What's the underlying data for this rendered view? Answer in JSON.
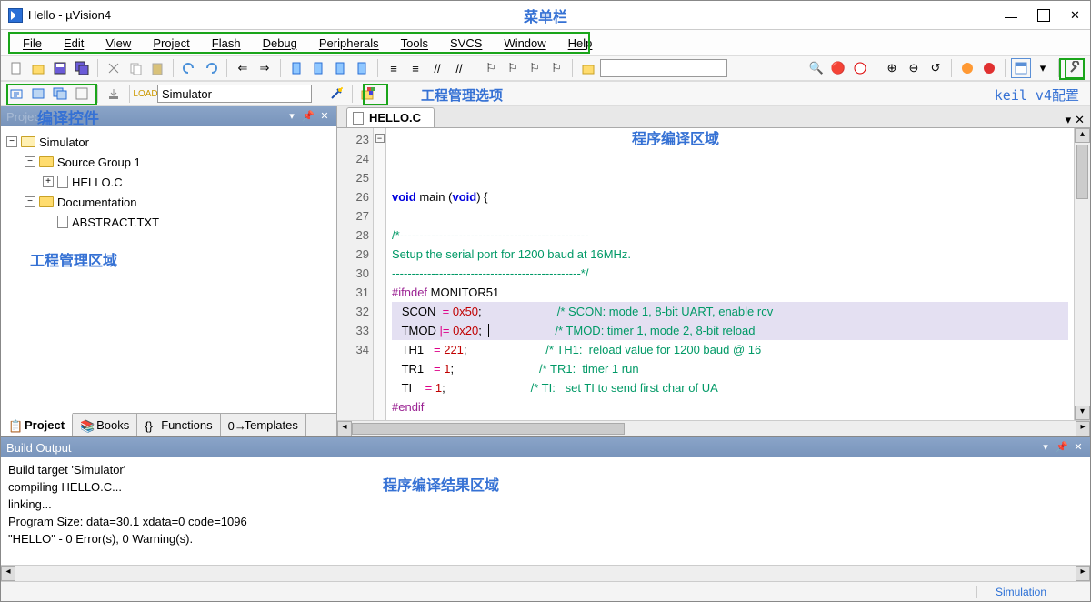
{
  "title": "Hello - µVision4",
  "titlebar_annotation": "菜单栏",
  "menu": [
    "File",
    "Edit",
    "View",
    "Project",
    "Flash",
    "Debug",
    "Peripherals",
    "Tools",
    "SVCS",
    "Window",
    "Help"
  ],
  "toolbar2_combo": "Simulator",
  "toolbar_far_combo": "",
  "annot_mgmt_options": "工程管理选项",
  "annot_keil_config": "keil v4配置",
  "project_pane": {
    "title": "Project",
    "title_annot": "编译控件",
    "root": "Simulator",
    "group": "Source Group 1",
    "file_c": "HELLO.C",
    "doc_group": "Documentation",
    "doc_file": "ABSTRACT.TXT",
    "area_annot": "工程管理区域"
  },
  "left_tabs": [
    "Project",
    "Books",
    "Functions",
    "Templates"
  ],
  "editor": {
    "tab": "HELLO.C",
    "area_annot": "程序编译区域",
    "lines": [
      {
        "n": 23,
        "html": "<span class='kw'>void</span> main (<span class='kw'>void</span>) {"
      },
      {
        "n": 24,
        "html": ""
      },
      {
        "n": 25,
        "html": "<span class='cm'>/*------------------------------------------------</span>"
      },
      {
        "n": 26,
        "html": "<span class='cm'>Setup the serial port for 1200 baud at 16MHz.</span>"
      },
      {
        "n": 27,
        "html": "<span class='cm'>------------------------------------------------*/</span>"
      },
      {
        "n": 28,
        "html": "<span class='pp'>#ifndef</span> MONITOR51"
      },
      {
        "n": 29,
        "html": "   SCON  <span class='op'>=</span> <span class='num'>0x50</span>;                       <span class='cm'>/* SCON: mode 1, 8-bit UART, enable rcv</span>",
        "hl": true
      },
      {
        "n": 30,
        "html": "   TMOD <span class='op'>|=</span> <span class='num'>0x20</span>;  <span class='cursor'></span>                    <span class='cm'>/* TMOD: timer 1, mode 2, 8-bit reload</span>",
        "hl": true
      },
      {
        "n": 31,
        "html": "   TH1   <span class='op'>=</span> <span class='num'>221</span>;                        <span class='cm'>/* TH1:  reload value for 1200 baud @ 16</span>"
      },
      {
        "n": 32,
        "html": "   TR1   <span class='op'>=</span> <span class='num'>1</span>;                          <span class='cm'>/* TR1:  timer 1 run</span>"
      },
      {
        "n": 33,
        "html": "   TI    <span class='op'>=</span> <span class='num'>1</span>;                          <span class='cm'>/* TI:   set TI to send first char of UA</span>"
      },
      {
        "n": 34,
        "html": "<span class='pp'>#endif</span>"
      }
    ]
  },
  "build": {
    "title": "Build Output",
    "annot": "程序编译结果区域",
    "lines": [
      "Build target 'Simulator'",
      "compiling HELLO.C...",
      "linking...",
      "Program Size: data=30.1 xdata=0 code=1096",
      "\"HELLO\" - 0 Error(s), 0 Warning(s)."
    ]
  },
  "status": {
    "mode": "Simulation"
  }
}
